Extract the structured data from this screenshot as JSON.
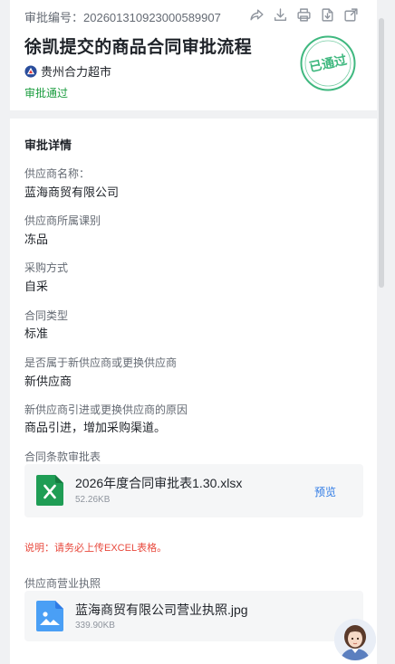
{
  "header": {
    "approval_no_label": "审批编号：",
    "approval_no_value": "202601310923000589907",
    "title": "徐凯提交的商品合同审批流程",
    "org_name": "贵州合力超市",
    "status_text": "审批通过",
    "stamp_text": "已通过"
  },
  "toolbar": {
    "icons": [
      "share-icon",
      "download-icon",
      "print-icon",
      "export-icon",
      "open-external-icon"
    ]
  },
  "details": {
    "section_title": "审批详情",
    "fields": [
      {
        "label": "供应商名称：",
        "value": "蓝海商贸有限公司"
      },
      {
        "label": "供应商所属课别",
        "value": "冻品"
      },
      {
        "label": "采购方式",
        "value": "自采"
      },
      {
        "label": "合同类型",
        "value": "标准"
      },
      {
        "label": "是否属于新供应商或更换供应商",
        "value": "新供应商"
      },
      {
        "label": "新供应商引进或更换供应商的原因",
        "value": "商品引进，增加采购渠道。"
      }
    ],
    "contract_label": "合同条款审批表",
    "contract_file": {
      "name": "2026年度合同审批表1.30.xlsx",
      "size": "52.26KB",
      "preview": "预览"
    },
    "note": "说明：请务必上传EXCEL表格。",
    "license_label": "供应商营业执照",
    "license_file": {
      "name": "蓝海商贸有限公司营业执照.jpg",
      "size": "339.90KB"
    }
  },
  "colors": {
    "status_green": "#1a9c3e",
    "stamp_green": "#3fb87f",
    "link_blue": "#2f7be5",
    "note_red": "#e8493d",
    "excel_green": "#1f9d55",
    "image_blue": "#4a9ff5"
  }
}
